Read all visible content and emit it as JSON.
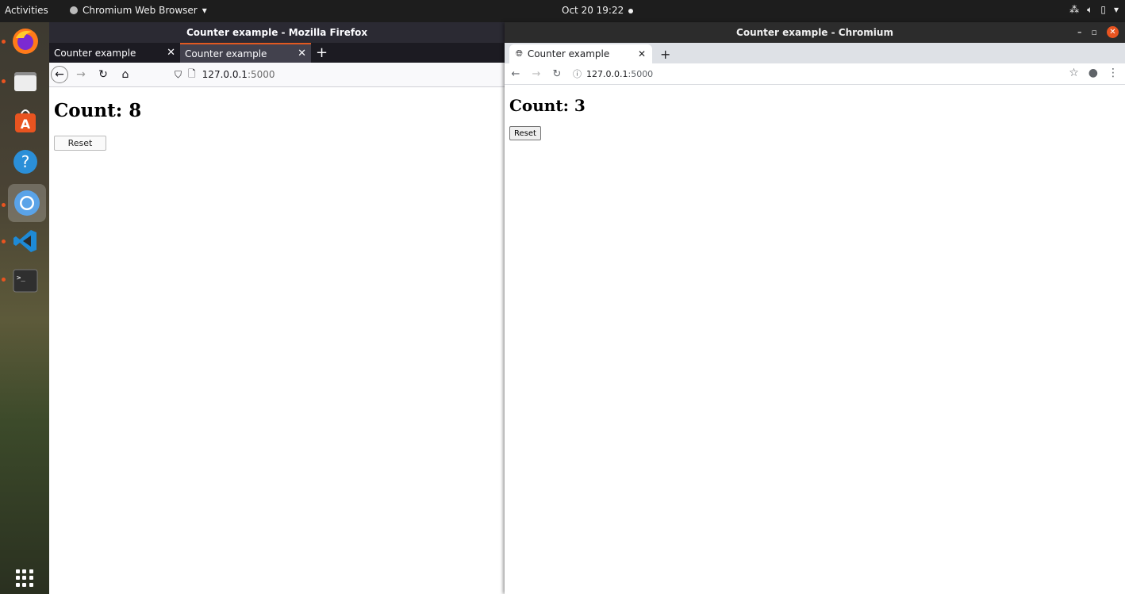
{
  "topbar": {
    "activities": "Activities",
    "app_menu": "Chromium Web Browser",
    "clock": "Oct 20  19:22"
  },
  "dock": {
    "items": [
      "firefox-icon",
      "files-icon",
      "software-center-icon",
      "help-icon",
      "chromium-icon",
      "vscode-icon",
      "terminal-icon"
    ]
  },
  "firefox": {
    "title": "Counter example - Mozilla Firefox",
    "tabs": [
      {
        "label": "Counter example"
      },
      {
        "label": "Counter example"
      }
    ],
    "url_host": "127.0.0.1",
    "url_port": ":5000",
    "count_text": "Count: 8",
    "reset_label": "Reset"
  },
  "chromium": {
    "title": "Counter example - Chromium",
    "tab_label": "Counter example",
    "url_host": "127.0.0.1",
    "url_port": ":5000",
    "count_text": "Count: 3",
    "reset_label": "Reset"
  }
}
